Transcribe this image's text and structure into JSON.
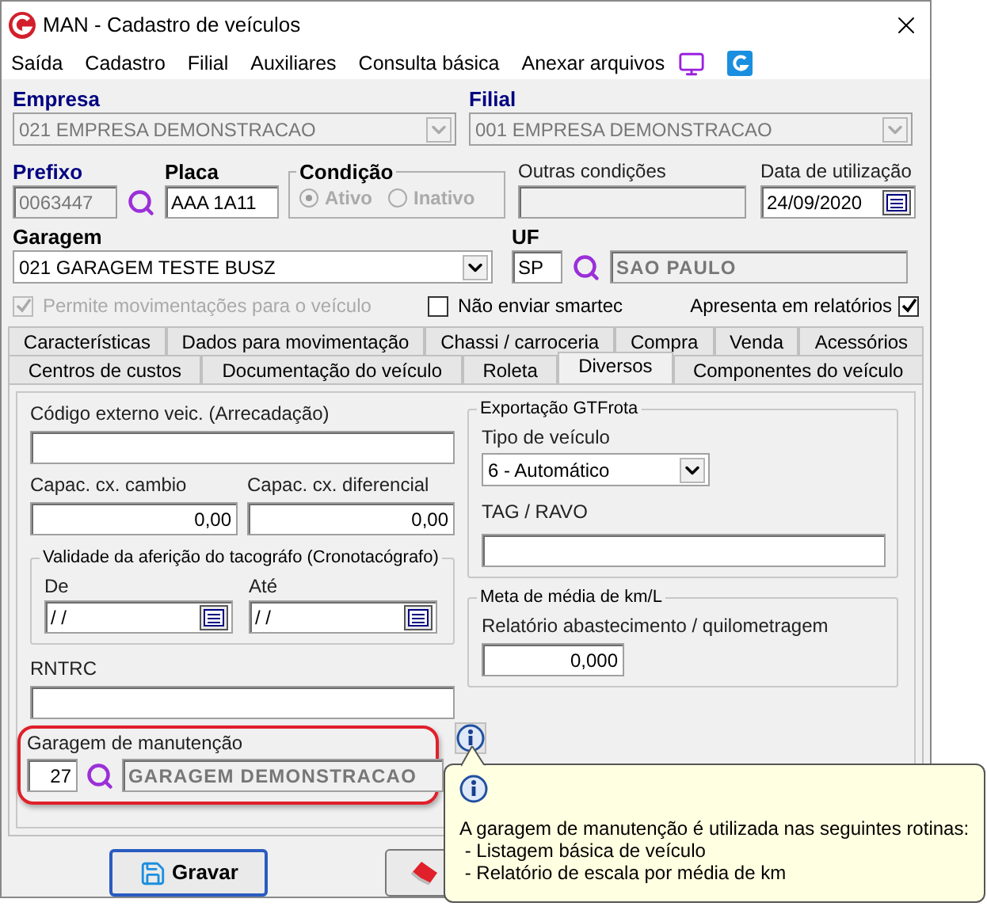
{
  "window": {
    "title": "MAN - Cadastro de veículos"
  },
  "menu": [
    "Saída",
    "Cadastro",
    "Filial",
    "Auxiliares",
    "Consulta básica",
    "Anexar arquivos"
  ],
  "empresa": {
    "label": "Empresa",
    "value": "021 EMPRESA DEMONSTRACAO",
    "disabled": true
  },
  "filial": {
    "label": "Filial",
    "value": "001 EMPRESA DEMONSTRACAO",
    "disabled": true
  },
  "prefixo": {
    "label": "Prefixo",
    "value": "0063447",
    "disabled": true
  },
  "placa": {
    "label": "Placa",
    "value": "AAA 1A11"
  },
  "condicao": {
    "label": "Condição",
    "disabled": true,
    "options": [
      {
        "label": "Ativo",
        "selected": true
      },
      {
        "label": "Inativo",
        "selected": false
      }
    ]
  },
  "outras_condicoes": {
    "label": "Outras condições"
  },
  "data_utilizacao": {
    "label": "Data de utilização",
    "value": "24/09/2020"
  },
  "garagem": {
    "label": "Garagem",
    "value": "021 GARAGEM TESTE BUSZ"
  },
  "uf": {
    "label": "UF",
    "value": "SP",
    "name": "SAO PAULO"
  },
  "checkboxes": [
    {
      "label": "Permite movimentações para o veículo",
      "checked": true,
      "disabled": true
    },
    {
      "label": "Não enviar smartec",
      "checked": false,
      "disabled": false
    },
    {
      "label": "Apresenta em relatórios",
      "checked": true,
      "disabled": false
    }
  ],
  "tab_rows": [
    [
      {
        "label": "Características",
        "selected": false
      },
      {
        "label": "Dados para movimentação",
        "selected": false
      },
      {
        "label": "Chassi / carroceria",
        "selected": false
      },
      {
        "label": "Compra",
        "selected": false
      },
      {
        "label": "Venda",
        "selected": false
      },
      {
        "label": "Acessórios",
        "selected": false
      }
    ],
    [
      {
        "label": "Centros de custos",
        "selected": false
      },
      {
        "label": "Documentação do veículo",
        "selected": false
      },
      {
        "label": "Roleta",
        "selected": false
      },
      {
        "label": "Diversos",
        "selected": true
      },
      {
        "label": "Componentes do veículo",
        "selected": false
      }
    ]
  ],
  "diversos": {
    "codigo_externo": {
      "label": "Código externo veic. (Arrecadação)"
    },
    "capac_cambio": {
      "label": "Capac. cx. cambio",
      "value": "0,00"
    },
    "capac_diferencial": {
      "label": "Capac. cx. diferencial",
      "value": "0,00"
    },
    "tacografo": {
      "title": "Validade da aferição do tacográfo (Cronotacógrafo)",
      "de": {
        "label": "De",
        "value": "/ /"
      },
      "ate": {
        "label": "Até",
        "value": "/ /"
      }
    },
    "rntrc": {
      "label": "RNTRC"
    },
    "garagem_manutencao": {
      "label": "Garagem de manutenção",
      "code": "27",
      "name": "GARAGEM DEMONSTRACAO"
    },
    "gtfrota": {
      "title": "Exportação GTFrota",
      "tipo": {
        "label": "Tipo de veículo",
        "value": "6 - Automático"
      },
      "tag": {
        "label": "TAG / RAVO"
      }
    },
    "meta": {
      "title": "Meta de média de km/L",
      "relatorio": {
        "label": "Relatório abastecimento / quilometragem",
        "value": "0,000"
      }
    }
  },
  "buttons": [
    {
      "kind": "save",
      "label": "Gravar"
    },
    {
      "kind": "clear"
    }
  ],
  "tooltip": {
    "lines": [
      "A garagem de manutenção é utilizada nas seguintes rotinas:",
      " - Listagem básica de veículo",
      " - Relatório de escala por média de km"
    ]
  }
}
